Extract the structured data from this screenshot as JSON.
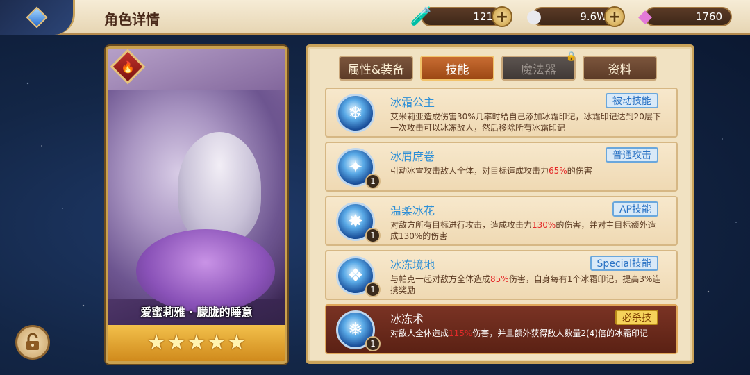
{
  "header": {
    "title": "角色详情",
    "resources": [
      {
        "icon": "potion-icon",
        "value": "121"
      },
      {
        "icon": "coin-icon",
        "value": "9.6W"
      },
      {
        "icon": "crystal-icon",
        "value": "1760"
      }
    ]
  },
  "character": {
    "name": "爱蜜莉雅 · 朦胧的睡意",
    "stars": 5,
    "element": "fire-icon"
  },
  "tabs": [
    {
      "label": "属性&装备",
      "state": "normal"
    },
    {
      "label": "技能",
      "state": "active"
    },
    {
      "label": "魔法器",
      "state": "locked"
    },
    {
      "label": "资料",
      "state": "normal"
    }
  ],
  "skills": [
    {
      "name": "冰霜公主",
      "type": "被动技能",
      "desc_pre": "艾米莉亚造成伤害30%几率时给自己添加冰霜印记，冰霜印记达到20层下一次攻击可以冰冻敌人，然后移除所有冰霜印记",
      "highlight": "",
      "desc_post": "",
      "level": ""
    },
    {
      "name": "冰屑席卷",
      "type": "普通攻击",
      "desc_pre": "引动冰雪攻击敌人全体，对目标造成攻击力",
      "highlight": "65%",
      "desc_post": "的伤害",
      "level": "1"
    },
    {
      "name": "温柔冰花",
      "type": "AP技能",
      "desc_pre": "对敌方所有目标进行攻击，造成攻击力",
      "highlight": "130%",
      "desc_post": "的伤害，并对主目标额外造成130%的伤害",
      "level": "1"
    },
    {
      "name": "冰冻境地",
      "type": "Special技能",
      "desc_pre": "与帕克一起对敌方全体造成",
      "highlight": "85%",
      "desc_post": "伤害，自身每有1个冰霜印记，提高3%连携奖励",
      "level": "1"
    },
    {
      "name": "冰冻术",
      "type": "必杀技",
      "desc_pre": "对敌人全体造成",
      "highlight": "115%",
      "desc_post": "伤害，并且额外获得敌人数量2(4)倍的冰霜印记",
      "level": "1"
    }
  ],
  "colors": {
    "accent": "#caa35a",
    "active_tab": "#c86c32",
    "highlight": "#e52a2a",
    "skill_name": "#2e8fd6"
  }
}
